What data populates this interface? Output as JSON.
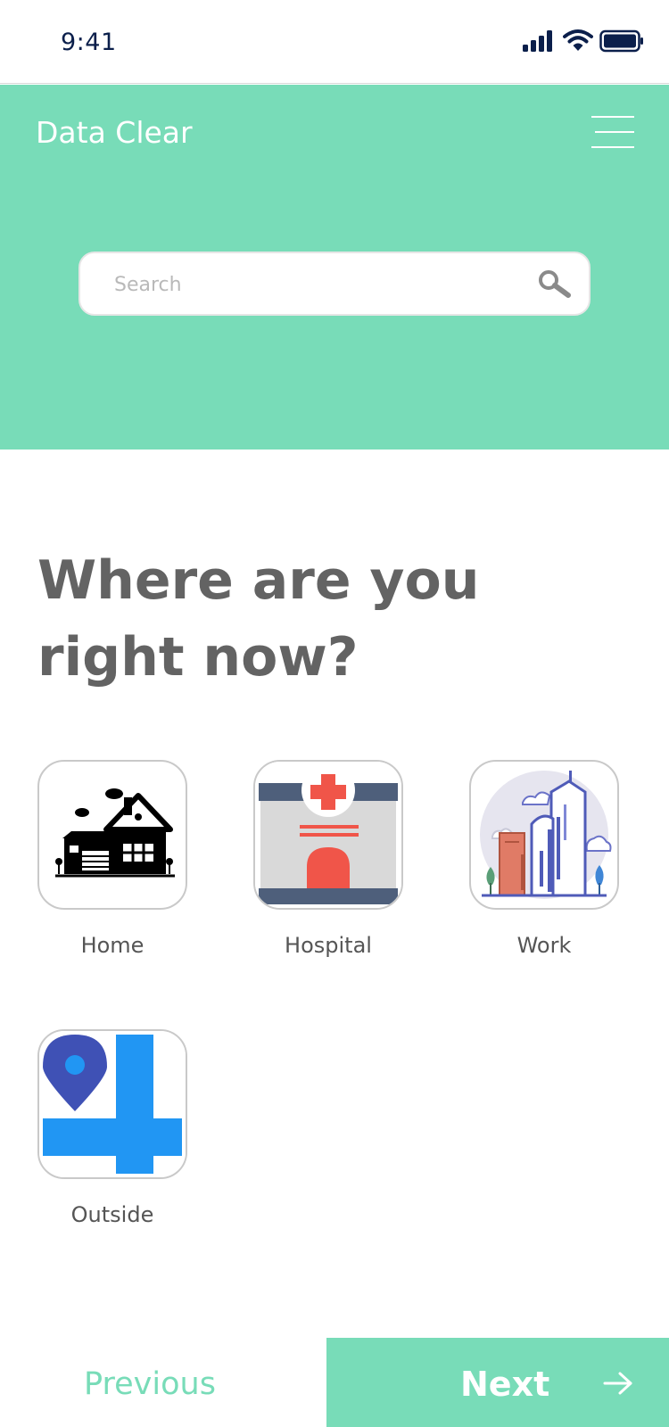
{
  "status_bar": {
    "time": "9:41"
  },
  "header": {
    "title": "Data Clear",
    "menu_icon": "hamburger-menu-icon",
    "background_color": "#78dcb8"
  },
  "search": {
    "placeholder": "Search",
    "value": "",
    "icon": "search-icon"
  },
  "question": {
    "line1": "Where are you",
    "line2": "right now?"
  },
  "locations": [
    {
      "label": "Home",
      "icon": "house-icon"
    },
    {
      "label": "Hospital",
      "icon": "hospital-icon"
    },
    {
      "label": "Work",
      "icon": "office-buildings-icon"
    },
    {
      "label": "Outside",
      "icon": "map-pin-road-icon"
    }
  ],
  "navigation": {
    "previous_label": "Previous",
    "next_label": "Next",
    "next_icon": "arrow-right-icon",
    "accent_color": "#78dcb8"
  }
}
